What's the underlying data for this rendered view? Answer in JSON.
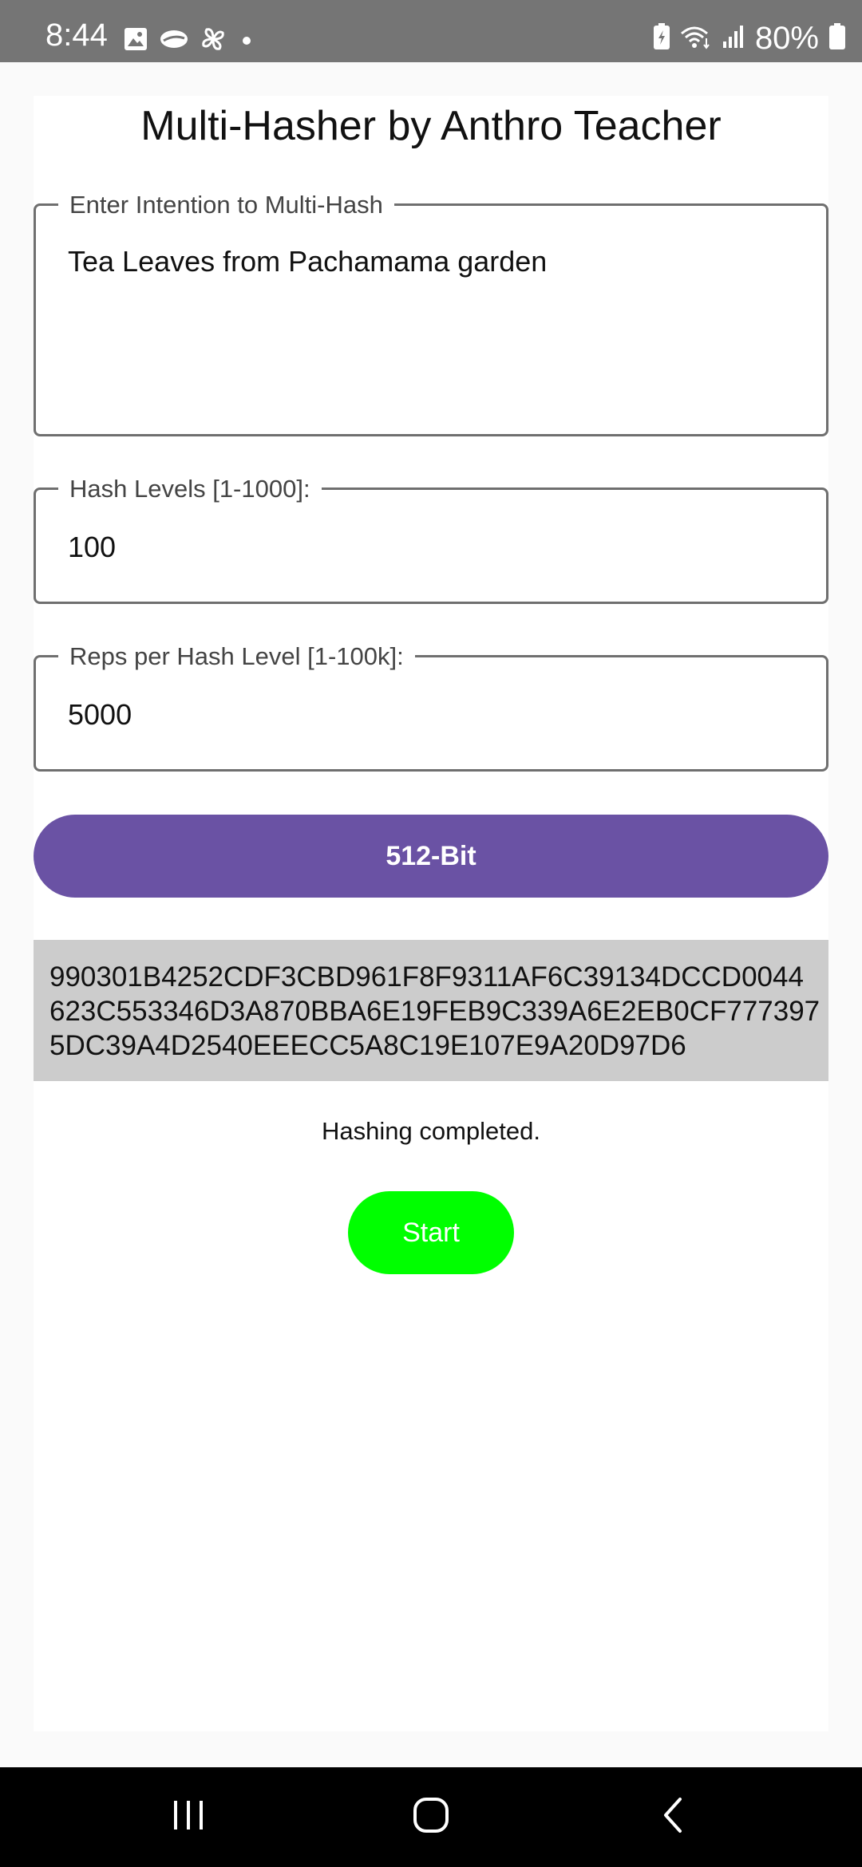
{
  "status_bar": {
    "time": "8:44",
    "left_icons": [
      "image-icon",
      "cloud-icon",
      "pinwheel-icon",
      "notification-dot-icon"
    ],
    "right_icons": [
      "battery-saver-icon",
      "wifi-icon",
      "signal-icon",
      "battery-icon"
    ],
    "battery_percent": "80%"
  },
  "app": {
    "title": "Multi-Hasher by Anthro Teacher"
  },
  "fields": {
    "intention": {
      "label": "Enter Intention to Multi-Hash",
      "value": "Tea Leaves from Pachamama garden"
    },
    "hash_levels": {
      "label": "Hash Levels [1-1000]:",
      "value": "100"
    },
    "reps": {
      "label": "Reps per Hash Level [1-100k]:",
      "value": "5000"
    }
  },
  "bit_button": {
    "label": "512-Bit"
  },
  "output": {
    "line1": "990301B4252CDF3CBD961F8F9311AF6C39134DCCD0044",
    "line2": "623C553346D3A870BBA6E19FEB9C339A6E2EB0CF777397",
    "line3": "5DC39A4D2540EEECC5A8C19E107E9A20D97D6"
  },
  "status_message": "Hashing completed.",
  "start_button": {
    "label": "Start"
  },
  "nav": {
    "recents_icon": "recents-icon",
    "home_icon": "home-icon",
    "back_icon": "back-icon"
  },
  "colors": {
    "status_bar": "#757575",
    "accent_purple": "#6a52a4",
    "start_green": "#00ff00",
    "output_bg": "#cccccc"
  }
}
